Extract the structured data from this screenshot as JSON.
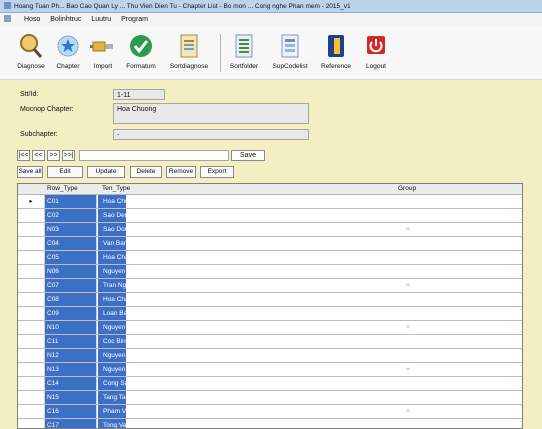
{
  "window": {
    "title": "Hoang Tuan Ph... Bao Cao Quan Ly ... Thu Vien Dien Tu - Chapter List - Bo mon ... Cong nghe Phan mem - 2015_v1"
  },
  "menu": [
    "Hoso",
    "Bolinhtruc",
    "Luutru",
    "Program"
  ],
  "toolbar": {
    "buttons": [
      {
        "label": "Diagnose",
        "icon": "magnifier-icon"
      },
      {
        "label": "Chapter",
        "icon": "star-globe-icon"
      },
      {
        "label": "Import",
        "icon": "connector-icon"
      },
      {
        "label": "Formatum",
        "icon": "green-check-icon"
      },
      {
        "label": "Sortdiagnose",
        "icon": "document-icon"
      },
      {
        "label": "Sortfolder",
        "icon": "stack-list-icon"
      },
      {
        "label": "SupCodelist",
        "icon": "table-list-icon"
      },
      {
        "label": "Reference",
        "icon": "book-icon"
      },
      {
        "label": "Logout",
        "icon": "power-icon"
      }
    ]
  },
  "form": {
    "stt_label": "Stt/Id:",
    "stt_value": "1-11",
    "chapter_label": "Mocnop Chapter:",
    "chapter_value": "Hoa Chuong",
    "subchapter_label": "Subchapter:",
    "subchapter_value": "-"
  },
  "nav": {
    "first": "|<<",
    "prev": "<<",
    "next": ">>",
    "last": ">>|",
    "search_placeholder": "",
    "save": "Save"
  },
  "actions": [
    "Save all",
    "Edit",
    "Update",
    "Delete",
    "Remove",
    "Export"
  ],
  "grid": {
    "columns": [
      "",
      "Row_Type",
      "Ten_Type",
      "Group"
    ],
    "rows": [
      {
        "marker": "▸",
        "id": "C01",
        "name": "Hoa Chuong",
        "group": ""
      },
      {
        "marker": "",
        "id": "C02",
        "name": "Sao Den",
        "group": ""
      },
      {
        "marker": "",
        "id": "N03",
        "name": "Sao Dong",
        "group": "+"
      },
      {
        "marker": "",
        "id": "C04",
        "name": "Van Bang",
        "group": ""
      },
      {
        "marker": "",
        "id": "C05",
        "name": "Hoa Chan",
        "group": ""
      },
      {
        "marker": "",
        "id": "N06",
        "name": "Nguyen Hoang Anh",
        "group": ""
      },
      {
        "marker": "",
        "id": "C07",
        "name": "Tran Ngoc",
        "group": "+"
      },
      {
        "marker": "",
        "id": "C08",
        "name": "Hoa Chan Chuong Sao",
        "group": ""
      },
      {
        "marker": "",
        "id": "C09",
        "name": "Loan Bang",
        "group": ""
      },
      {
        "marker": "",
        "id": "N10",
        "name": "Nguyen Van Khanh",
        "group": "+"
      },
      {
        "marker": "",
        "id": "C11",
        "name": "Coc Binh Chuong Kieu Hoa Sao Chi",
        "group": ""
      },
      {
        "marker": "",
        "id": "N12",
        "name": "Nguyen Thanh Tuan Tung Thanh Nguyen Hoang Ngoc",
        "group": ""
      },
      {
        "marker": "",
        "id": "N13",
        "name": "Nguyen Hoang Anh",
        "group": "+"
      },
      {
        "marker": "",
        "id": "C14",
        "name": "Cong Sao Duong Dien Cong Hoang",
        "group": ""
      },
      {
        "marker": "",
        "id": "N15",
        "name": "Tang Tan Thanh Binh Vu Do Bang Duc Ngoc Tho",
        "group": ""
      },
      {
        "marker": "",
        "id": "C16",
        "name": "Pham Van Chinh Son Thai Lan",
        "group": "+"
      },
      {
        "marker": "",
        "id": "C17",
        "name": "Tong Van Ngo Tran Van Tho Tien",
        "group": ""
      }
    ]
  },
  "colors": {
    "form_bg": "#f3efc3",
    "selection": "#3c6fc6",
    "titlebar": "#bcd3ee"
  }
}
